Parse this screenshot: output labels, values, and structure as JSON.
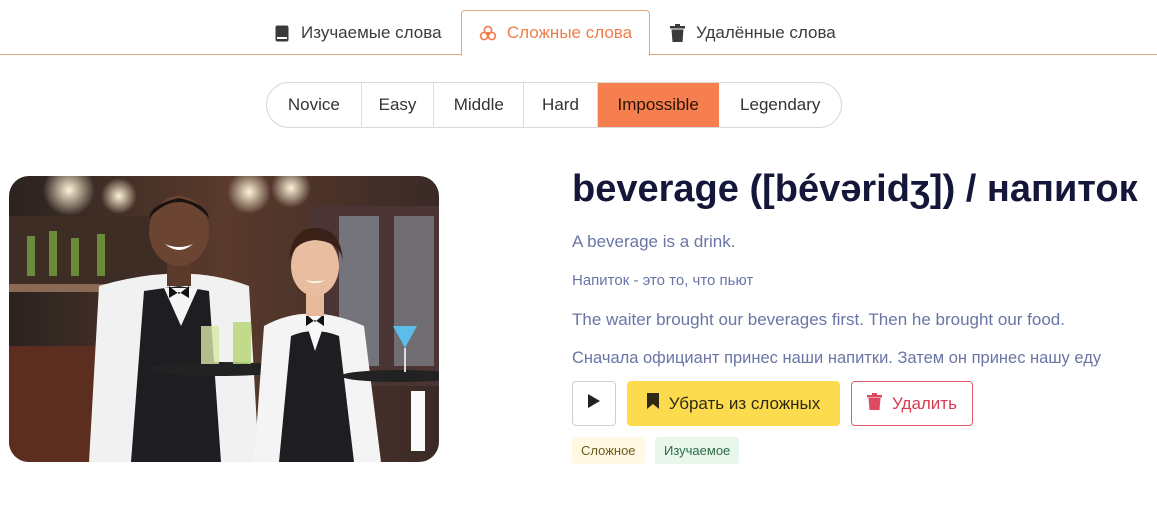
{
  "tabs": [
    {
      "label": "Изучаемые слова",
      "icon": "book-icon",
      "active": false
    },
    {
      "label": "Сложные слова",
      "icon": "biohazard-icon",
      "active": true
    },
    {
      "label": "Удалённые слова",
      "icon": "trash-icon",
      "active": false
    }
  ],
  "levels": [
    {
      "label": "Novice",
      "active": false
    },
    {
      "label": "Easy",
      "active": false
    },
    {
      "label": "Middle",
      "active": false
    },
    {
      "label": "Hard",
      "active": false
    },
    {
      "label": "Impossible",
      "active": true
    },
    {
      "label": "Legendary",
      "active": false
    }
  ],
  "card": {
    "title": "beverage ([bévəridʒ]) / напиток",
    "meaning_en": "A beverage is a drink.",
    "meaning_ru": "Напиток - это то, что пьют",
    "example_en": "The waiter brought our beverages first. Then he brought our food.",
    "example_ru": "Сначала официант принес наши напитки. Затем он принес нашу еду",
    "play_icon": "play-icon",
    "remove_hard_label": "Убрать из сложных",
    "remove_hard_icon": "bookmark-icon",
    "delete_label": "Удалить",
    "delete_icon": "trash-icon",
    "badges": [
      "Сложное",
      "Изучаемое"
    ]
  },
  "colors": {
    "accent": "#f57f4f",
    "tab_active_text": "#f07c4a",
    "title": "#15173a",
    "muted_text": "#6a75a6",
    "hard_button": "#fddb4f",
    "delete": "#d8394f"
  }
}
